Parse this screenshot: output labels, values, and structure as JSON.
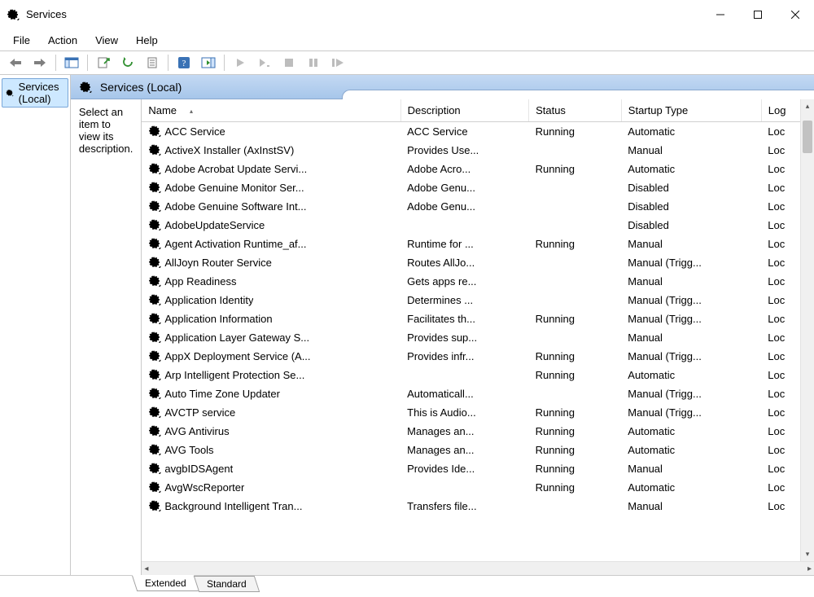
{
  "window": {
    "title": "Services"
  },
  "menu": {
    "file": "File",
    "action": "Action",
    "view": "View",
    "help": "Help"
  },
  "tree": {
    "root_label": "Services (Local)"
  },
  "ext_header_title": "Services (Local)",
  "desc_pane_text": "Select an item to view its description.",
  "columns": {
    "name": "Name",
    "description": "Description",
    "status": "Status",
    "startup": "Startup Type",
    "logon": "Log"
  },
  "tabs": {
    "extended": "Extended",
    "standard": "Standard"
  },
  "services": [
    {
      "name": "ACC Service",
      "description": "ACC Service",
      "status": "Running",
      "startup": "Automatic",
      "logon": "Loc"
    },
    {
      "name": "ActiveX Installer (AxInstSV)",
      "description": "Provides Use...",
      "status": "",
      "startup": "Manual",
      "logon": "Loc"
    },
    {
      "name": "Adobe Acrobat Update Servi...",
      "description": "Adobe Acro...",
      "status": "Running",
      "startup": "Automatic",
      "logon": "Loc"
    },
    {
      "name": "Adobe Genuine Monitor Ser...",
      "description": "Adobe Genu...",
      "status": "",
      "startup": "Disabled",
      "logon": "Loc"
    },
    {
      "name": "Adobe Genuine Software Int...",
      "description": "Adobe Genu...",
      "status": "",
      "startup": "Disabled",
      "logon": "Loc"
    },
    {
      "name": "AdobeUpdateService",
      "description": "",
      "status": "",
      "startup": "Disabled",
      "logon": "Loc"
    },
    {
      "name": "Agent Activation Runtime_af...",
      "description": "Runtime for ...",
      "status": "Running",
      "startup": "Manual",
      "logon": "Loc"
    },
    {
      "name": "AllJoyn Router Service",
      "description": "Routes AllJo...",
      "status": "",
      "startup": "Manual (Trigg...",
      "logon": "Loc"
    },
    {
      "name": "App Readiness",
      "description": "Gets apps re...",
      "status": "",
      "startup": "Manual",
      "logon": "Loc"
    },
    {
      "name": "Application Identity",
      "description": "Determines ...",
      "status": "",
      "startup": "Manual (Trigg...",
      "logon": "Loc"
    },
    {
      "name": "Application Information",
      "description": "Facilitates th...",
      "status": "Running",
      "startup": "Manual (Trigg...",
      "logon": "Loc"
    },
    {
      "name": "Application Layer Gateway S...",
      "description": "Provides sup...",
      "status": "",
      "startup": "Manual",
      "logon": "Loc"
    },
    {
      "name": "AppX Deployment Service (A...",
      "description": "Provides infr...",
      "status": "Running",
      "startup": "Manual (Trigg...",
      "logon": "Loc"
    },
    {
      "name": "Arp Intelligent Protection Se...",
      "description": "",
      "status": "Running",
      "startup": "Automatic",
      "logon": "Loc"
    },
    {
      "name": "Auto Time Zone Updater",
      "description": "Automaticall...",
      "status": "",
      "startup": "Manual (Trigg...",
      "logon": "Loc"
    },
    {
      "name": "AVCTP service",
      "description": "This is Audio...",
      "status": "Running",
      "startup": "Manual (Trigg...",
      "logon": "Loc"
    },
    {
      "name": "AVG Antivirus",
      "description": "Manages an...",
      "status": "Running",
      "startup": "Automatic",
      "logon": "Loc"
    },
    {
      "name": "AVG Tools",
      "description": "Manages an...",
      "status": "Running",
      "startup": "Automatic",
      "logon": "Loc"
    },
    {
      "name": "avgbIDSAgent",
      "description": "Provides Ide...",
      "status": "Running",
      "startup": "Manual",
      "logon": "Loc"
    },
    {
      "name": "AvgWscReporter",
      "description": "",
      "status": "Running",
      "startup": "Automatic",
      "logon": "Loc"
    },
    {
      "name": "Background Intelligent Tran...",
      "description": "Transfers file...",
      "status": "",
      "startup": "Manual",
      "logon": "Loc"
    }
  ]
}
